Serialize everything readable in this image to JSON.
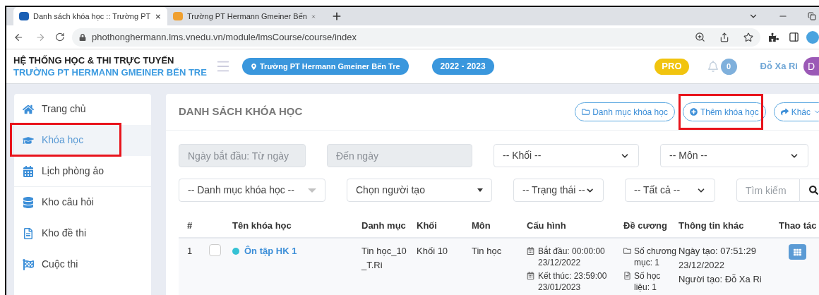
{
  "browser": {
    "tabs": [
      {
        "title": "Danh sách khóa học :: Trường PT",
        "selected": true
      },
      {
        "title": "Trường PT Hermann Gmeiner Bến",
        "selected": false
      }
    ],
    "url": "phothonghermann.lms.vnedu.vn/module/lmsCourse/course/index"
  },
  "header": {
    "system_title": "HỆ THỐNG HỌC & THI TRỰC TUYẾN",
    "school_title": "TRƯỜNG PT HERMANN GMEINER BẾN TRE",
    "school_badge": "Trường PT Hermann Gmeiner Bến Tre",
    "year_badge": "2022 - 2023",
    "pro_badge": "PRO",
    "notification_count": "0",
    "user_name": "Đỗ Xa Ri",
    "avatar_letter": "D"
  },
  "sidebar": {
    "items": [
      {
        "label": "Trang chủ",
        "selected": false,
        "annotated": false
      },
      {
        "label": "Khóa học",
        "selected": true,
        "annotated": true
      },
      {
        "label": "Lịch phòng ảo",
        "selected": false,
        "annotated": false
      },
      {
        "label": "Kho câu hỏi",
        "selected": false,
        "annotated": false
      },
      {
        "label": "Kho đề thi",
        "selected": false,
        "annotated": false
      },
      {
        "label": "Cuộc thi",
        "selected": false,
        "annotated": false
      }
    ]
  },
  "main": {
    "title": "DANH SÁCH KHÓA HỌC",
    "actions": [
      {
        "label": "Danh mục khóa học",
        "annotated": false,
        "dropdown": false
      },
      {
        "label": "Thêm khóa học",
        "annotated": true,
        "dropdown": false
      },
      {
        "label": "Khác",
        "annotated": false,
        "dropdown": true
      }
    ],
    "filter_rows": [
      [
        {
          "kind": "date",
          "placeholder": "Ngày bắt đầu: Từ ngày"
        },
        {
          "kind": "date",
          "placeholder": "Đến ngày"
        },
        {
          "kind": "select",
          "value": "-- Khối --"
        },
        {
          "kind": "select",
          "value": "-- Môn --"
        }
      ],
      [
        {
          "kind": "combo",
          "value": "-- Danh mục khóa học --"
        },
        {
          "kind": "native",
          "value": "Chọn người tạo"
        },
        {
          "kind": "select",
          "value": "-- Trạng thái --"
        },
        {
          "kind": "select",
          "value": "-- Tất cả --"
        },
        {
          "kind": "search",
          "placeholder": "Tìm kiếm"
        }
      ]
    ],
    "table": {
      "columns": [
        "#",
        "Tên khóa học",
        "Danh mục",
        "Khối",
        "Môn",
        "Cấu hình",
        "Đề cương",
        "Thông tin khác",
        "Thao tác"
      ],
      "rows": [
        {
          "number": "1",
          "checked": false,
          "color": "#36c2d4",
          "name": "Ôn tập HK 1",
          "category": "Tin học_10_T.Ri",
          "grade": "Khối 10",
          "subject": "Tin học",
          "start": "Bắt đầu: 00:00:00 23/12/2022",
          "end": "Kết thúc: 23:59:00 23/01/2023",
          "chapters": "Số chương mục: 1",
          "materials": "Số học liệu: 1",
          "created": "Ngày tạo: 07:51:29 23/12/2022",
          "creator": "Người tạo: Đỗ Xa Ri"
        }
      ]
    }
  }
}
